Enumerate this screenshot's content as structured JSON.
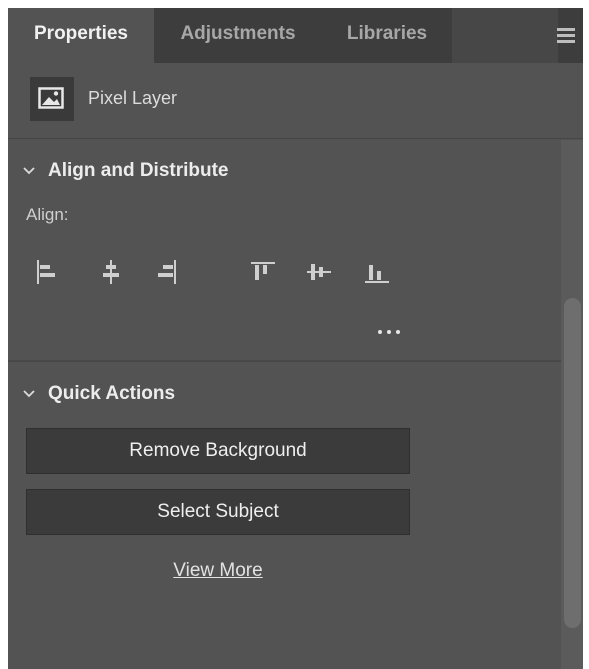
{
  "tabs": [
    {
      "label": "Properties",
      "active": true
    },
    {
      "label": "Adjustments",
      "active": false
    },
    {
      "label": "Libraries",
      "active": false
    }
  ],
  "panel_menu_icon": "hamburger-menu-icon",
  "layer": {
    "icon": "pixel-layer-icon",
    "label": "Pixel Layer"
  },
  "align_distribute": {
    "title": "Align and Distribute",
    "align_label": "Align:",
    "buttons": [
      "align-left-edges-icon",
      "align-horizontal-centers-icon",
      "align-right-edges-icon",
      "align-top-edges-icon",
      "align-vertical-centers-icon",
      "align-bottom-edges-icon"
    ],
    "more_label": "…"
  },
  "quick_actions": {
    "title": "Quick Actions",
    "remove_background": "Remove Background",
    "select_subject": "Select Subject",
    "view_more": "View More"
  },
  "colors": {
    "panel_bg": "#535353",
    "tab_bar_bg": "#3d3d3d",
    "button_bg": "#3b3b3b",
    "text": "#eeeeee"
  }
}
